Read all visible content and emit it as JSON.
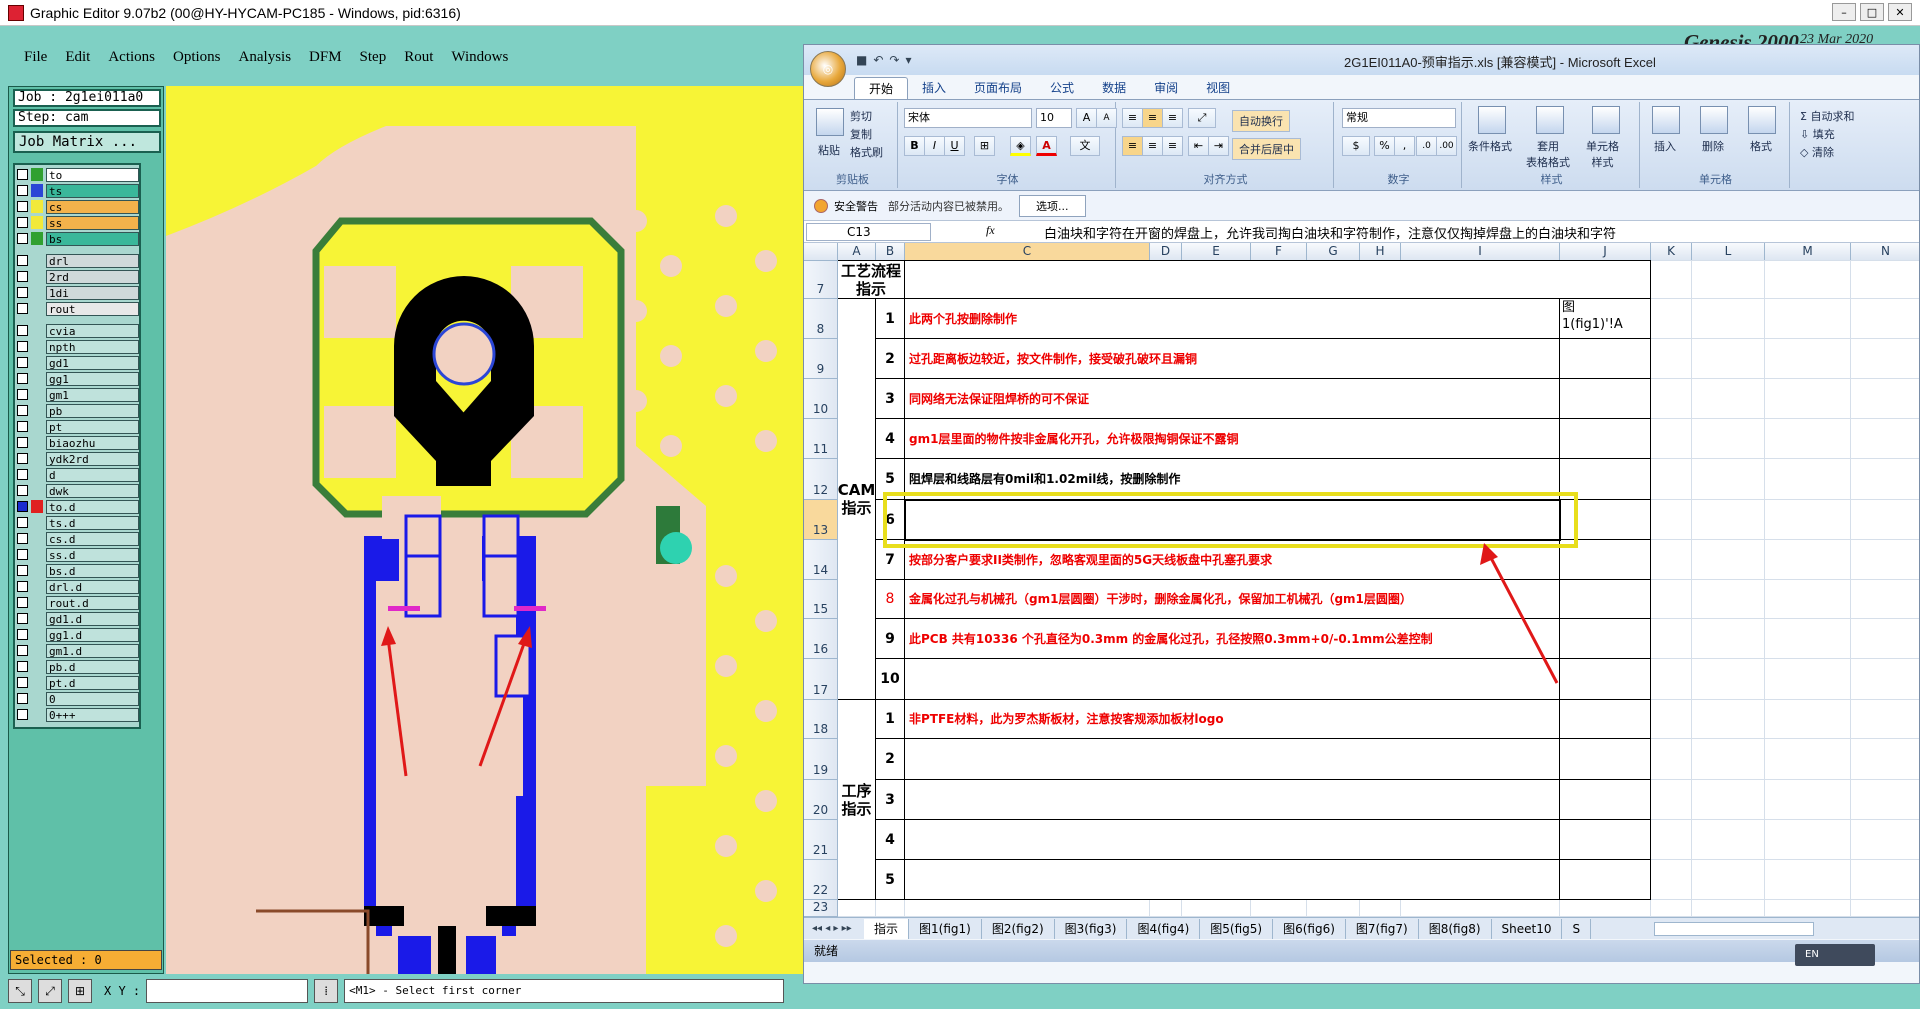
{
  "ge": {
    "title": "Graphic Editor 9.07b2 (00@HY-HYCAM-PC185 - Windows, pid:6316)",
    "menu": [
      "File",
      "Edit",
      "Actions",
      "Options",
      "Analysis",
      "DFM",
      "Step",
      "Rout",
      "Windows"
    ],
    "job": "Job : 2g1ei011a0",
    "step": "Step: cam",
    "job_matrix": "Job Matrix ...",
    "layers": [
      {
        "name": "to",
        "color": "#ffffff",
        "swatch": "#30a030"
      },
      {
        "name": "ts",
        "color": "#3ab79a",
        "swatch": "#2b46d6"
      },
      {
        "name": "cs",
        "color": "#f3b24b",
        "swatch": "#f2e93a"
      },
      {
        "name": "ss",
        "color": "#f3b24b",
        "swatch": "#f2e93a"
      },
      {
        "name": "bs",
        "color": "#3ab79a",
        "swatch": "#30a030"
      },
      {
        "name": "drl",
        "color": "#cfd9da",
        "swatch": ""
      },
      {
        "name": "2rd",
        "color": "#cfd9da",
        "swatch": ""
      },
      {
        "name": "1di",
        "color": "#cfd9da",
        "swatch": ""
      },
      {
        "name": "rout",
        "color": "#e8e8e8",
        "swatch": ""
      },
      {
        "name": "cvia",
        "color": "#bfe2dc",
        "swatch": ""
      },
      {
        "name": "npth",
        "color": "#bfe2dc",
        "swatch": ""
      },
      {
        "name": "gd1",
        "color": "#bfe2dc",
        "swatch": ""
      },
      {
        "name": "gg1",
        "color": "#bfe2dc",
        "swatch": ""
      },
      {
        "name": "gm1",
        "color": "#bfe2dc",
        "swatch": ""
      },
      {
        "name": "pb",
        "color": "#bfe2dc",
        "swatch": ""
      },
      {
        "name": "pt",
        "color": "#bfe2dc",
        "swatch": ""
      },
      {
        "name": "biaozhu",
        "color": "#bfe2dc",
        "swatch": ""
      },
      {
        "name": "ydk2rd",
        "color": "#bfe2dc",
        "swatch": ""
      },
      {
        "name": "d",
        "color": "#bfe2dc",
        "swatch": ""
      },
      {
        "name": "dwk",
        "color": "#bfe2dc",
        "swatch": ""
      },
      {
        "name": "to.d",
        "color": "#bfe2dc",
        "swatch": "#e02020"
      },
      {
        "name": "ts.d",
        "color": "#bfe2dc",
        "swatch": ""
      },
      {
        "name": "cs.d",
        "color": "#bfe2dc",
        "swatch": ""
      },
      {
        "name": "ss.d",
        "color": "#bfe2dc",
        "swatch": ""
      },
      {
        "name": "bs.d",
        "color": "#bfe2dc",
        "swatch": ""
      },
      {
        "name": "drl.d",
        "color": "#bfe2dc",
        "swatch": ""
      },
      {
        "name": "rout.d",
        "color": "#bfe2dc",
        "swatch": ""
      },
      {
        "name": "gd1.d",
        "color": "#bfe2dc",
        "swatch": ""
      },
      {
        "name": "gg1.d",
        "color": "#bfe2dc",
        "swatch": ""
      },
      {
        "name": "gm1.d",
        "color": "#bfe2dc",
        "swatch": ""
      },
      {
        "name": "pb.d",
        "color": "#bfe2dc",
        "swatch": ""
      },
      {
        "name": "pt.d",
        "color": "#bfe2dc",
        "swatch": ""
      },
      {
        "name": "0",
        "color": "#bfe2dc",
        "swatch": ""
      },
      {
        "name": "0+++",
        "color": "#bfe2dc",
        "swatch": ""
      }
    ],
    "selected": "Selected : 0",
    "xy_label": "X Y :",
    "message": "<M1> - Select first corner",
    "genesis_logo": "Genesis 2000",
    "genesis_date": "23 Mar 2020"
  },
  "excel": {
    "title": "2G1EI011A0-预审指示.xls [兼容模式] - Microsoft Excel",
    "tabs": [
      "开始",
      "插入",
      "页面布局",
      "公式",
      "数据",
      "审阅",
      "视图"
    ],
    "ribbon": {
      "paste": "粘贴",
      "cut": "剪切",
      "copy": "复制",
      "format_painter": "格式刷",
      "font_name": "宋体",
      "font_size": "10",
      "wrap_text": "自动换行",
      "merge_center": "合并后居中",
      "number_format": "常规",
      "cond_format": "条件格式",
      "table_format": "套用\n表格格式",
      "cell_style": "单元格\n样式",
      "insert": "插入",
      "delete": "删除",
      "format": "格式",
      "autosum": "自动求和",
      "fill": "填充",
      "clear": "清除",
      "groups": [
        "剪贴板",
        "字体",
        "对齐方式",
        "数字",
        "样式",
        "单元格"
      ]
    },
    "security": {
      "title": "安全警告",
      "message": "部分活动内容已被禁用。",
      "button": "选项..."
    },
    "namebox": "C13",
    "fx": "fx",
    "formula": "白油块和字符在开窗的焊盘上，允许我司掏白油块和字符制作，注意仅仅掏掉焊盘上的白油块和字符",
    "columns": [
      "A",
      "B",
      "C",
      "D",
      "E",
      "F",
      "G",
      "H",
      "I",
      "J",
      "K",
      "L",
      "M",
      "N"
    ],
    "rows": [
      "7",
      "8",
      "9",
      "10",
      "11",
      "12",
      "13",
      "14",
      "15",
      "16",
      "17",
      "18",
      "19",
      "20",
      "21",
      "22",
      "23"
    ],
    "header_cell": "工艺流程\n指示",
    "section_cam": "CAM\n指示",
    "section_proc": "工序\n指示",
    "j8": "图\n1(fig1)'!A",
    "cam_items": [
      {
        "n": "1",
        "t": "此两个孔按删除制作",
        "c": "red"
      },
      {
        "n": "2",
        "t": "过孔距离板边较近，按文件制作，接受破孔破环且漏铜",
        "c": "red"
      },
      {
        "n": "3",
        "t": "同网络无法保证阻焊桥的可不保证",
        "c": "red"
      },
      {
        "n": "4",
        "t": "gm1层里面的物件按非金属化开孔，允许极限掏铜保证不露铜",
        "c": "red"
      },
      {
        "n": "5",
        "t": "阻焊层和线路层有0mil和1.02mil线，按删除制作",
        "c": "black"
      },
      {
        "n": "6",
        "t": "白油块和字符在开窗的焊盘上，允许我司掏白油块和字符制作，注意仅仅掏掉焊盘上的白油块和字符",
        "c": "red"
      },
      {
        "n": "7",
        "t": "按部分客户要求II类制作，忽略客观里面的5G天线板盘中孔塞孔要求",
        "c": "red"
      },
      {
        "n": "8",
        "t": "金属化过孔与机械孔（gm1层圆圈）干涉时，删除金属化孔，保留加工机械孔（gm1层圆圈）",
        "c": "red"
      },
      {
        "n": "9",
        "t": "此PCB 共有10336 个孔直径为0.3mm 的金属化过孔，孔径按照0.3mm+0/-0.1mm公差控制",
        "c": "red"
      },
      {
        "n": "10",
        "t": "",
        "c": "red"
      }
    ],
    "proc_items": [
      {
        "n": "1",
        "t": "非PTFE材料，此为罗杰斯板材，注意按客规添加板材logo",
        "c": "red"
      },
      {
        "n": "2",
        "t": "",
        "c": "red"
      },
      {
        "n": "3",
        "t": "",
        "c": "red"
      },
      {
        "n": "4",
        "t": "",
        "c": "red"
      },
      {
        "n": "5",
        "t": "",
        "c": "red"
      }
    ],
    "sheet_tabs": [
      "指示",
      "图1(fig1)",
      "图2(fig2)",
      "图3(fig3)",
      "图4(fig4)",
      "图5(fig5)",
      "图6(fig6)",
      "图7(fig7)",
      "图8(fig8)",
      "Sheet10",
      "S"
    ],
    "status": "就绪",
    "lang": "EN"
  }
}
